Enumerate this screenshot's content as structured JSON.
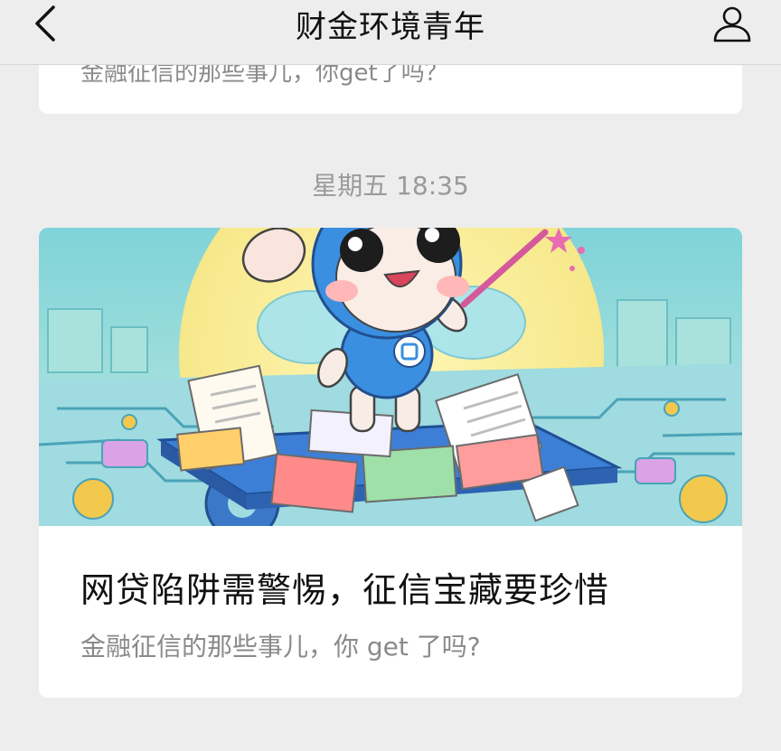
{
  "header": {
    "title": "财金环境青年",
    "back_icon": "chevron-left-icon",
    "profile_icon": "person-icon"
  },
  "previous_card": {
    "text_fragment": "金融征信的那些事儿，你get了吗？"
  },
  "feed": {
    "timestamp": "星期五 18:35",
    "article": {
      "title": "网贷陷阱需警惕，征信宝藏要珍惜",
      "description": "金融征信的那些事儿，你 get 了吗?"
    }
  },
  "colors": {
    "background": "#ededed",
    "card": "#ffffff",
    "title_text": "#111111",
    "secondary_text": "#8a8a8a",
    "mascot_blue": "#3a8fe0"
  }
}
